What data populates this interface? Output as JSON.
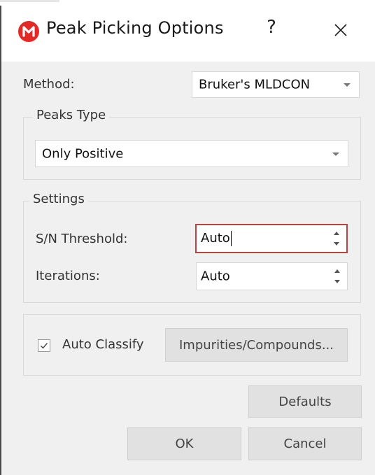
{
  "window": {
    "title": "Peak Picking Options",
    "help_label": "?",
    "close_label": "✕"
  },
  "method": {
    "label": "Method:",
    "value": "Bruker's MLDCON"
  },
  "peaks_type": {
    "group_title": "Peaks Type",
    "value": "Only Positive"
  },
  "settings": {
    "group_title": "Settings",
    "sn_label": "S/N Threshold:",
    "sn_value": "Auto",
    "iterations_label": "Iterations:",
    "iterations_value": "Auto"
  },
  "classify": {
    "auto_classify_label": "Auto Classify",
    "auto_classify_checked": true,
    "impurities_button": "Impurities/Compounds..."
  },
  "buttons": {
    "defaults": "Defaults",
    "ok": "OK",
    "cancel": "Cancel"
  },
  "colors": {
    "accent_focus": "#b84246",
    "app_icon": "#e32826"
  },
  "icons": {
    "app": "mnova-logo-icon",
    "help": "help-icon",
    "close": "close-icon",
    "check": "check-icon"
  }
}
